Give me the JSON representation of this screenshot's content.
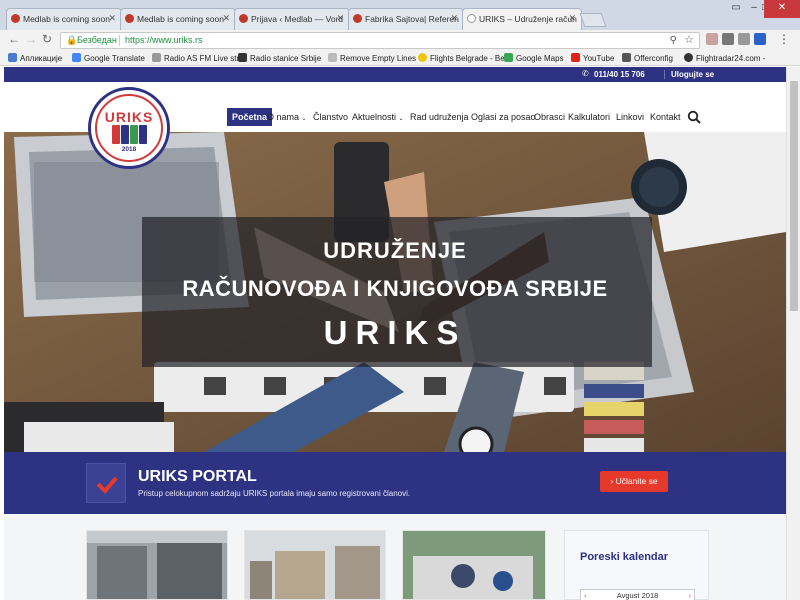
{
  "browser": {
    "tabs": [
      {
        "title": "Medlab is coming soon",
        "color": "#c0392b"
      },
      {
        "title": "Medlab is coming soon",
        "color": "#c0392b"
      },
      {
        "title": "Prijava ‹ Medlab — Vord",
        "color": "#c0392b"
      },
      {
        "title": "Fabrika Sajtova| Referen",
        "color": "#c0392b"
      },
      {
        "title": "URIKS – Udruženje račun",
        "color": "#2d3283"
      }
    ],
    "secure_label": "Безбедан",
    "url": "https://www.uriks.rs",
    "bookmarks": [
      {
        "label": "Апликације",
        "icon": "apps-icon",
        "color": "#4a7bd0"
      },
      {
        "label": "Google Translate",
        "icon": "translate-icon",
        "color": "#4285f4"
      },
      {
        "label": "Radio AS FM Live str",
        "icon": "radio-icon",
        "color": "#999999"
      },
      {
        "label": "Radio stanice Srbije",
        "icon": "radio-icon",
        "color": "#333333"
      },
      {
        "label": "Remove Empty Lines",
        "icon": "page-icon",
        "color": "#bbbbbb"
      },
      {
        "label": "Flights Belgrade - Be",
        "icon": "flight-icon",
        "color": "#f1c40f"
      },
      {
        "label": "Google Maps",
        "icon": "maps-icon",
        "color": "#34a853"
      },
      {
        "label": "YouTube",
        "icon": "youtube-icon",
        "color": "#e62117"
      },
      {
        "label": "Offerconfig",
        "icon": "offer-icon",
        "color": "#555555"
      },
      {
        "label": "Flightradar24.com -",
        "icon": "radar-icon",
        "color": "#333333"
      }
    ]
  },
  "site": {
    "phone": "011/40 15 706",
    "login": "Ulogujte se",
    "logo": {
      "name": "URIKS",
      "year": "2018"
    },
    "menu": [
      "Početna",
      "O nama",
      "Članstvo",
      "Aktuelnosti",
      "Rad udruženja",
      "Oglasi za posao",
      "Obrasci",
      "Kalkulatori",
      "Linkovi",
      "Kontakt"
    ],
    "hero": {
      "line1": "UDRUŽENJE",
      "line2": "RAČUNOVOĐA I KNJIGOVOĐA SRBIJE",
      "line3": "URIKS"
    },
    "portal": {
      "title": "URIKS PORTAL",
      "subtitle": "Pristup celokupnom sadržaju URIKS portala imaju samo registrovani članovi.",
      "button": "Učlanite se"
    },
    "sidebar": {
      "title": "Poreski kalendar",
      "month": "Avgust 2018"
    }
  },
  "colors": {
    "brand": "#2d3283",
    "accent": "#e53a2b"
  }
}
